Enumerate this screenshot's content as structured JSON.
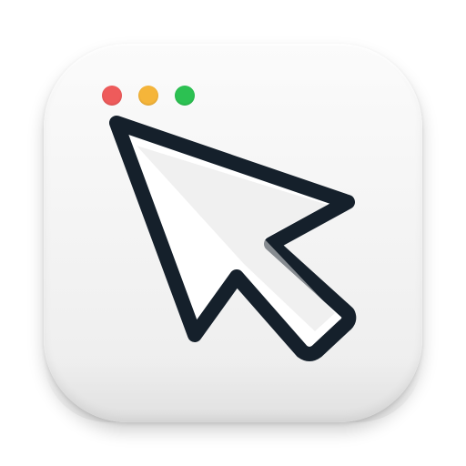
{
  "app_icon": {
    "name": "cursor-app-icon",
    "background_color": "#f4f4f4"
  },
  "window_controls": [
    {
      "name": "close-dot",
      "color": "#ee5b5b"
    },
    {
      "name": "minimize-dot",
      "color": "#f5b53a"
    },
    {
      "name": "zoom-dot",
      "color": "#2cc152"
    }
  ],
  "cursor": {
    "icon": "arrow-pointer-icon",
    "outline_color": "#15202b",
    "fill_color": "#ffffff",
    "shade_color": "#e4e4e4"
  }
}
